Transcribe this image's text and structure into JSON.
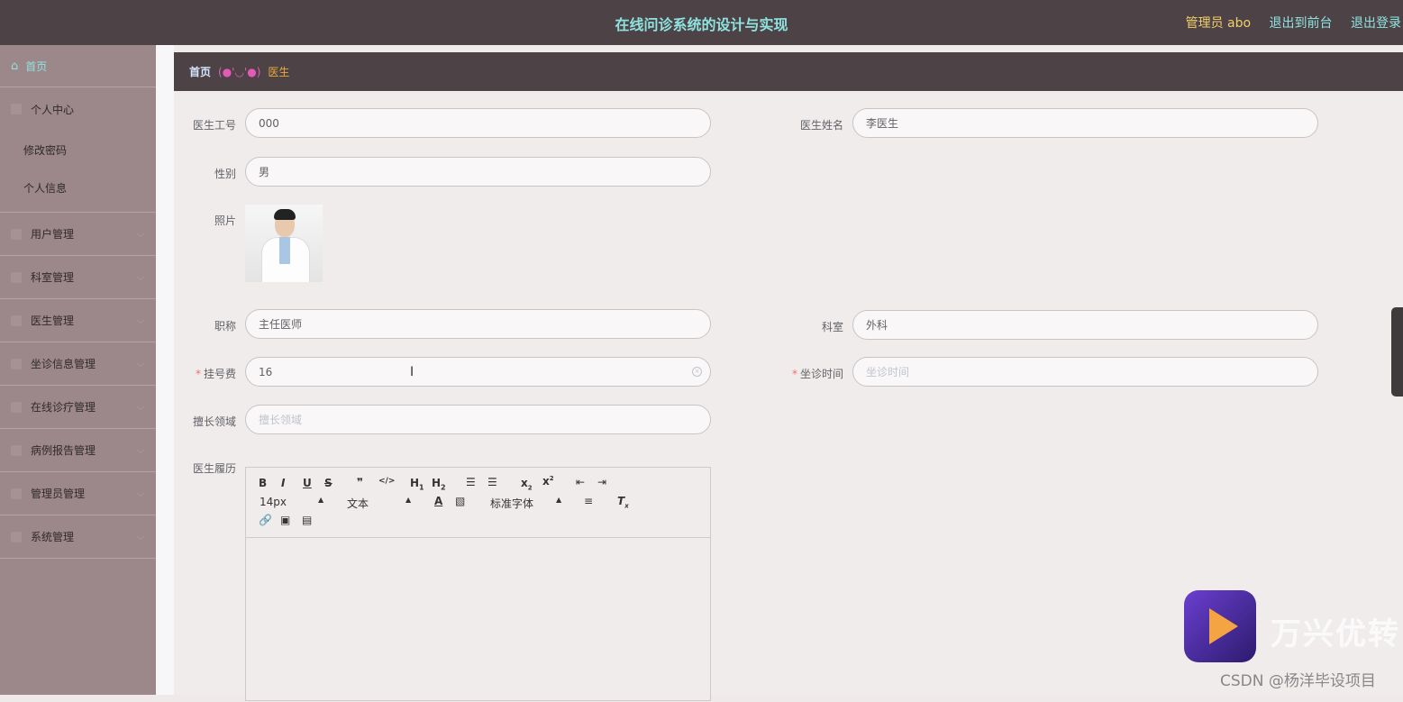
{
  "header": {
    "title": "在线问诊系统的设计与实现",
    "admin_label": "管理员 abo",
    "to_frontend": "退出到前台",
    "logout": "退出登录"
  },
  "sidebar": {
    "home": "首页",
    "personal_center": "个人中心",
    "personal_sub": [
      "修改密码",
      "个人信息"
    ],
    "menus": [
      "用户管理",
      "科室管理",
      "医生管理",
      "坐诊信息管理",
      "在线诊疗管理",
      "病例报告管理",
      "管理员管理",
      "系统管理"
    ]
  },
  "breadcrumb": {
    "home": "首页",
    "face": "(●'◡'●)",
    "current": "医生"
  },
  "form": {
    "doctor_id": {
      "label": "医生工号",
      "value": "000"
    },
    "doctor_name": {
      "label": "医生姓名",
      "value": "李医生"
    },
    "gender": {
      "label": "性别",
      "value": "男"
    },
    "photo": {
      "label": "照片"
    },
    "title": {
      "label": "职称",
      "value": "主任医师"
    },
    "department": {
      "label": "科室",
      "value": "外科"
    },
    "fee": {
      "label": "挂号费",
      "value": "16"
    },
    "visit_time": {
      "label": "坐诊时间",
      "placeholder": "坐诊时间"
    },
    "specialty": {
      "label": "擅长领域",
      "placeholder": "擅长领域"
    },
    "resume": {
      "label": "医生履历"
    }
  },
  "editor": {
    "font_size": "14px",
    "block_format": "文本",
    "font_family": "标准字体"
  },
  "watermark": {
    "brand": "万兴优转",
    "csdn": "CSDN @杨洋毕设项目"
  },
  "colors": {
    "topbar": "#4d4347",
    "sidebar": "#9c878a",
    "accent": "#8fe3df",
    "admin": "#f2cf6a"
  }
}
